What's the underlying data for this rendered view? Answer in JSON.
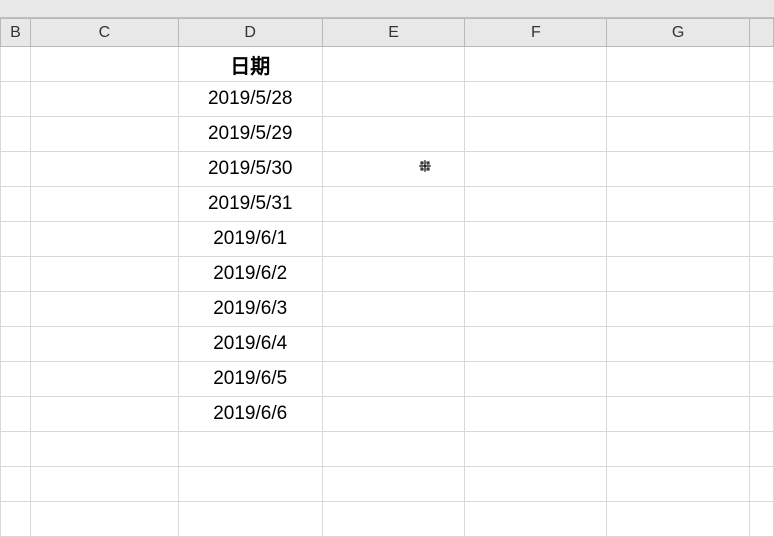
{
  "columns": {
    "B": "B",
    "C": "C",
    "D": "D",
    "E": "E",
    "F": "F",
    "G": "G"
  },
  "table": {
    "header": "日期",
    "rows": [
      "2019/5/28",
      "2019/5/29",
      "2019/5/30",
      "2019/5/31",
      "2019/6/1",
      "2019/6/2",
      "2019/6/3",
      "2019/6/4",
      "2019/6/5",
      "2019/6/6"
    ]
  }
}
